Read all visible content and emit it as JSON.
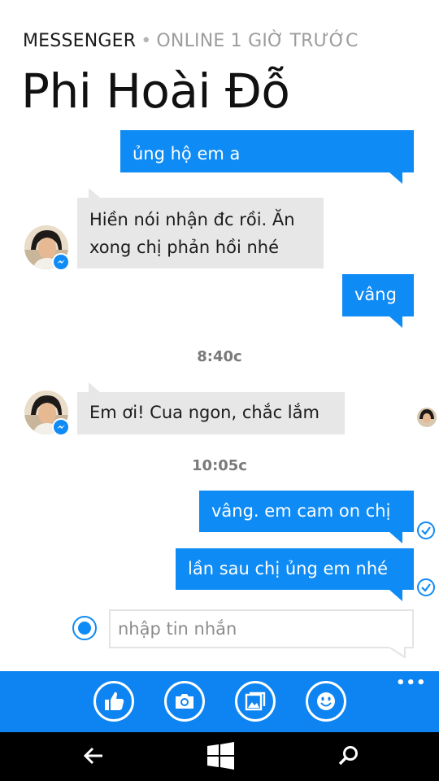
{
  "header": {
    "app_name": "MESSENGER",
    "separator": "•",
    "status": "ONLINE 1 GIỜ TRƯỚC",
    "title": "Phi Hoài Đỗ"
  },
  "messages": {
    "m1": "ủng hộ em a",
    "m2_line1": "Hiền nói nhận đc rồi. Ăn",
    "m2_line2": "xong chị phản hồi nhé",
    "m3": "vâng",
    "time1": "8:40c",
    "m4": "Em ơi! Cua ngon, chắc lắm",
    "time2": "10:05c",
    "m5": "vâng. em cam on chị",
    "m6": "lần sau chị ủng em nhé"
  },
  "composer": {
    "placeholder": "nhập tin nhắn"
  },
  "appbar": {
    "buttons": [
      "like-icon",
      "camera-icon",
      "photo-gallery-icon",
      "emoji-icon"
    ],
    "more": "•••"
  },
  "navbar": {
    "buttons": [
      "back-arrow-icon",
      "windows-start-icon",
      "search-icon"
    ]
  },
  "colors": {
    "accent": "#0f8bf5",
    "appbar": "#0d84f2",
    "incoming_bubble": "#e7e7e7",
    "navbar": "#000000"
  }
}
